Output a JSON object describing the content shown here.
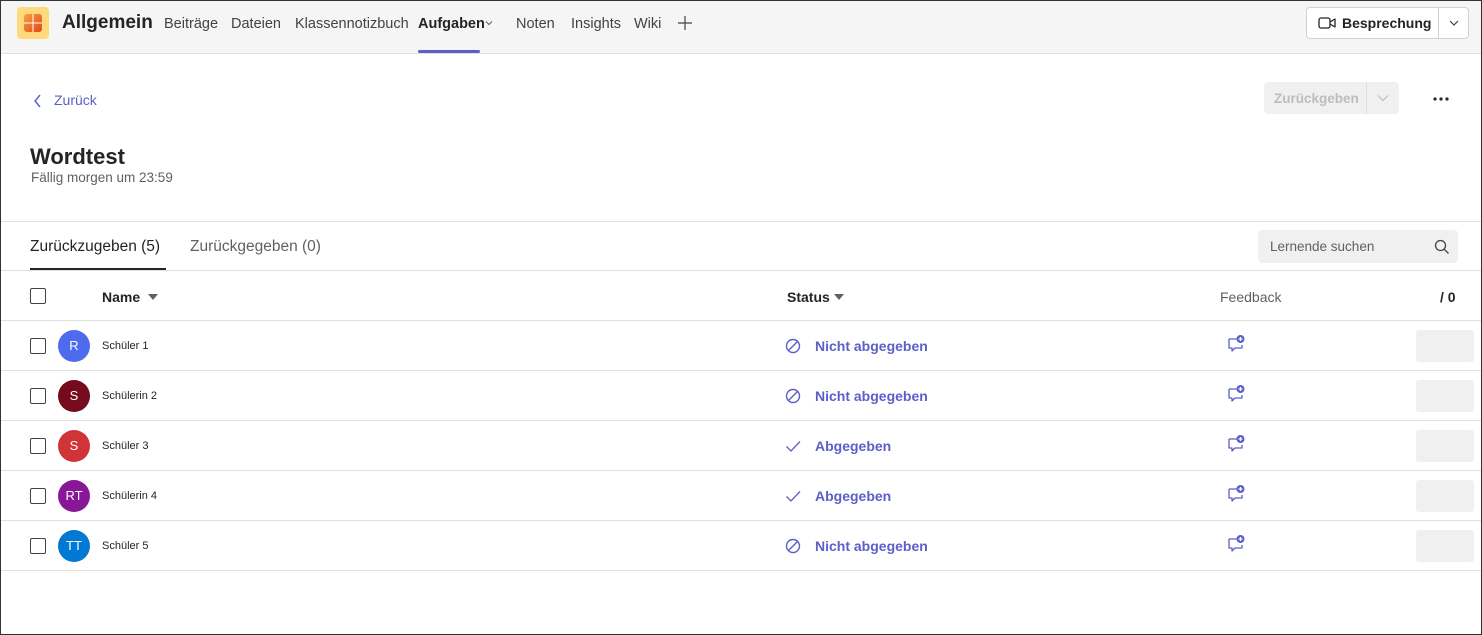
{
  "header": {
    "channel_title": "Allgemein",
    "tabs": [
      {
        "label": "Beiträge"
      },
      {
        "label": "Dateien"
      },
      {
        "label": "Klassennotizbuch"
      },
      {
        "label": "Aufgaben"
      },
      {
        "label": "Noten"
      },
      {
        "label": "Insights"
      },
      {
        "label": "Wiki"
      }
    ],
    "active_tab": "Aufgaben",
    "meeting_button": "Besprechung"
  },
  "assignment": {
    "back_label": "Zurück",
    "return_button": "Zurückgeben",
    "title": "Wordtest",
    "due": "Fällig morgen um 23:59"
  },
  "tabs": {
    "to_return": "Zurückzugeben (5)",
    "returned": "Zurückgegeben (0)"
  },
  "search": {
    "placeholder": "Lernende suchen"
  },
  "table": {
    "headers": {
      "name": "Name",
      "status": "Status",
      "feedback": "Feedback",
      "points": "/ 0"
    },
    "rows": [
      {
        "initials": "R",
        "name": "Schüler 1",
        "status": "Nicht abgegeben",
        "status_type": "not-submitted",
        "avatar_color": "#4f6bed"
      },
      {
        "initials": "S",
        "name": "Schülerin 2",
        "status": "Nicht abgegeben",
        "status_type": "not-submitted",
        "avatar_color": "#750b1c"
      },
      {
        "initials": "S",
        "name": "Schüler 3",
        "status": "Abgegeben",
        "status_type": "submitted",
        "avatar_color": "#d13438"
      },
      {
        "initials": "RT",
        "name": "Schülerin 4",
        "status": "Abgegeben",
        "status_type": "submitted",
        "avatar_color": "#881798"
      },
      {
        "initials": "TT",
        "name": "Schüler 5",
        "status": "Nicht abgegeben",
        "status_type": "not-submitted",
        "avatar_color": "#0078d4"
      }
    ]
  },
  "colors": {
    "accent": "#5b5fc7",
    "topbar": "#f5f5f5"
  }
}
